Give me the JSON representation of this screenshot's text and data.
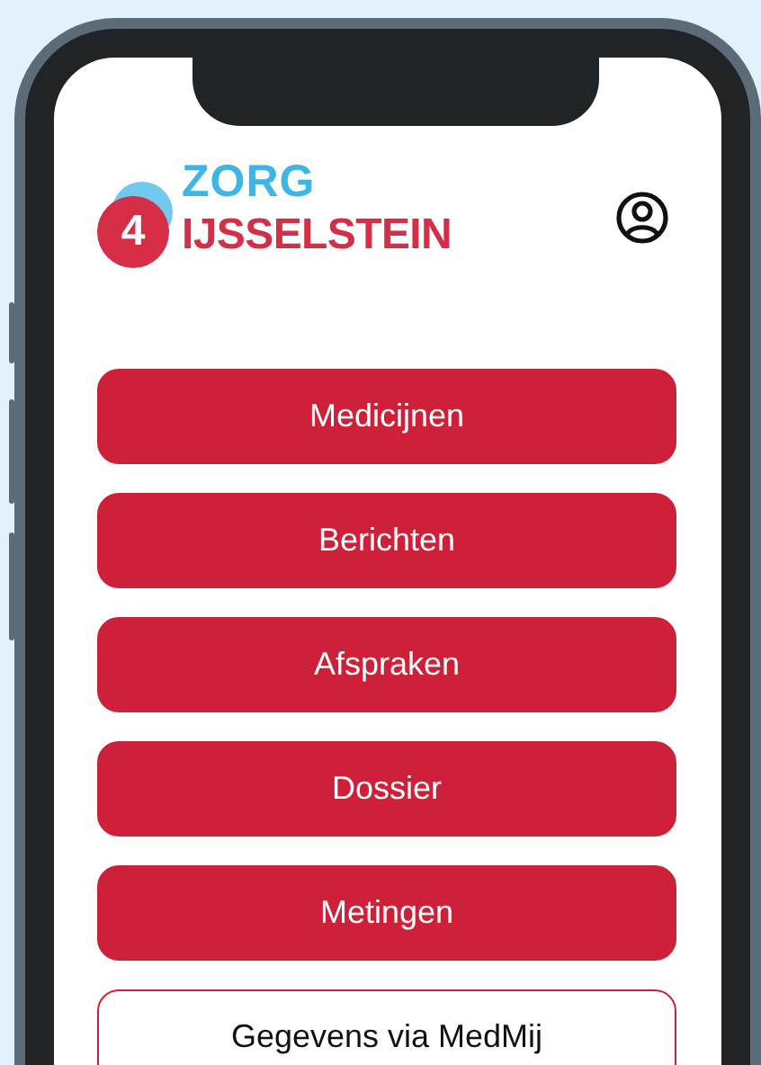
{
  "logo": {
    "top": "ZORG",
    "badge": "4",
    "bottom": "IJSSELSTEIN"
  },
  "menu": [
    {
      "label": "Medicijnen",
      "kind": "filled"
    },
    {
      "label": "Berichten",
      "kind": "filled"
    },
    {
      "label": "Afspraken",
      "kind": "filled"
    },
    {
      "label": "Dossier",
      "kind": "filled"
    },
    {
      "label": "Metingen",
      "kind": "filled"
    },
    {
      "label": "Gegevens via MedMij",
      "kind": "outline"
    }
  ]
}
